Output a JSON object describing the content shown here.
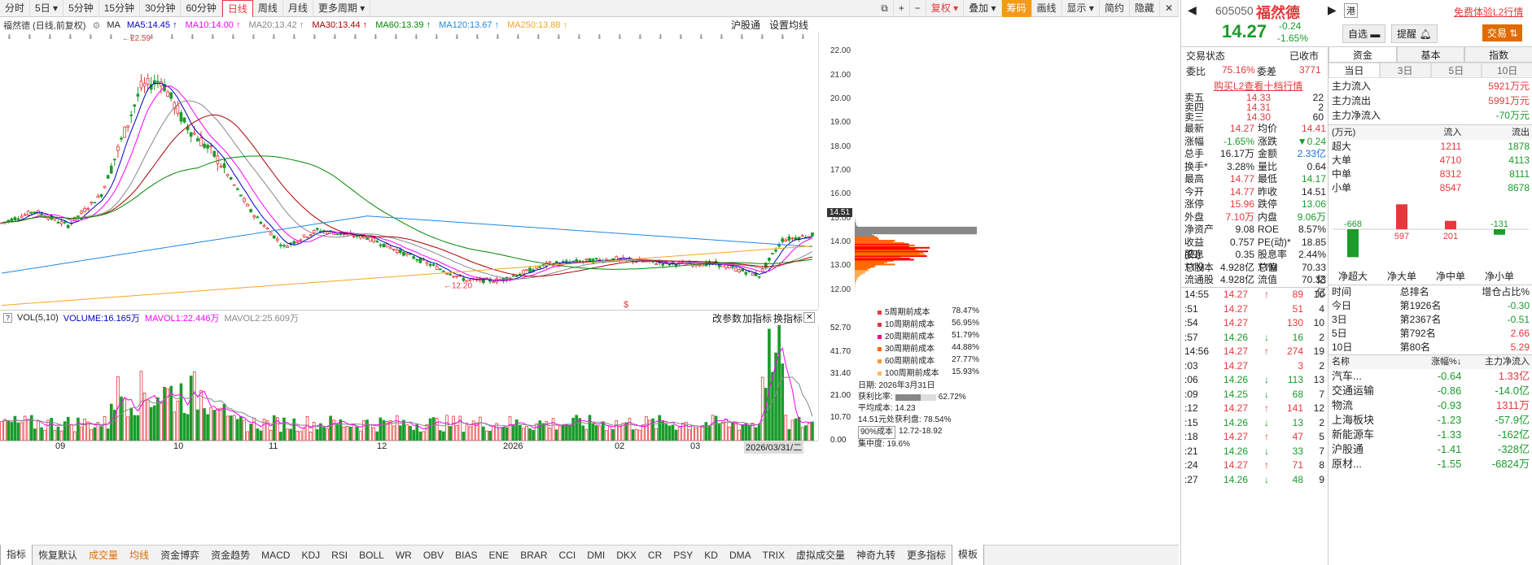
{
  "toolbar": {
    "left": [
      "分时",
      "5日",
      "5分钟",
      "15分钟",
      "30分钟",
      "60分钟",
      "日线",
      "周线",
      "月线",
      "更多周期"
    ],
    "right": [
      "复权",
      "叠加",
      "筹码",
      "画线",
      "显示",
      "简约",
      "隐藏"
    ]
  },
  "ma_row": {
    "label": "福然德 (日线,前复权)",
    "ma": "MA",
    "items": [
      {
        "t": "MA5:14.45",
        "c": "#0000c0"
      },
      {
        "t": "MA10:14.00",
        "c": "#ff00ff"
      },
      {
        "t": "MA20:13.42",
        "c": "#888888"
      },
      {
        "t": "MA30:13.44",
        "c": "#aa0000"
      },
      {
        "t": "MA60:13.39",
        "c": "#008800"
      },
      {
        "t": "MA120:13.67",
        "c": "#1e88e5"
      },
      {
        "t": "MA250:13.88",
        "c": "#f5a623"
      }
    ],
    "hgt": "沪股通",
    "setma": "设置均线"
  },
  "price_axis": [
    "22.00",
    "21.00",
    "20.00",
    "19.00",
    "18.00",
    "17.00",
    "16.00",
    "15.00",
    "14.00",
    "13.00",
    "12.00"
  ],
  "cur_price": "14.51",
  "annotations": {
    "high": "22.59",
    "low": "12.20"
  },
  "vol_row": {
    "label": "VOL(5,10)",
    "volume": "VOLUME:16.165万",
    "mavol1": "MAVOL1:22.446万",
    "mavol2": "MAVOL2:25.609万",
    "btn1": "改参数",
    "btn2": "加指标",
    "btn3": "换指标"
  },
  "vol_axis": [
    "52.70",
    "41.70",
    "31.40",
    "21.00",
    "10.70",
    "0.00"
  ],
  "x_labels": [
    "09",
    "10",
    "11",
    "12",
    "2026",
    "02",
    "03"
  ],
  "x_cursor": "2026/03/31/二",
  "chip_legend": [
    {
      "t": "5周期前成本",
      "v": "78.47%",
      "c": "#e4393c"
    },
    {
      "t": "10周期前成本",
      "v": "56.95%",
      "c": "#e4393c"
    },
    {
      "t": "20周期前成本",
      "v": "51.79%",
      "c": "#ff0080"
    },
    {
      "t": "30周期前成本",
      "v": "44.88%",
      "c": "#ff6600"
    },
    {
      "t": "60周期前成本",
      "v": "27.77%",
      "c": "#ff9933"
    },
    {
      "t": "100周期前成本",
      "v": "15.93%",
      "c": "#ffbb66"
    }
  ],
  "chip_info": {
    "date": "日期: 2026年3月31日",
    "profit_label": "获利比率:",
    "profit_val": "62.72%",
    "avg": "平均成本: 14.23",
    "line": "14.51元处获利盘: 78.54%",
    "cost_sel": "90%成本",
    "cost_range": "12.72-18.92",
    "conc": "集中度: 19.6%"
  },
  "bottom": [
    "指标",
    "恢复默认",
    "成交量",
    "均线",
    "资金博弈",
    "资金趋势",
    "MACD",
    "KDJ",
    "RSI",
    "BOLL",
    "WR",
    "OBV",
    "BIAS",
    "ENE",
    "BRAR",
    "CCI",
    "DMI",
    "DKX",
    "CR",
    "PSY",
    "KD",
    "DMA",
    "TRIX",
    "虚拟成交量",
    "神奇九转",
    "更多指标",
    "模板"
  ],
  "stock": {
    "code": "605050",
    "name": "福然德",
    "market": "港",
    "trial": "免费体验L2行情",
    "price": "14.27",
    "chg": "-0.24",
    "pct": "-1.65%",
    "btn_zx": "自选",
    "btn_tx": "提醒",
    "btn_jy": "交易"
  },
  "status": {
    "trade": "交易状态",
    "state": "已收市",
    "wb_label": "委比",
    "wb": "75.16%",
    "wc_label": "委差",
    "wc": "3771",
    "l2": "购买L2查看十档行情"
  },
  "book": [
    {
      "n": "卖五",
      "p": "14.33",
      "v": "22"
    },
    {
      "n": "卖四",
      "p": "14.31",
      "v": "2"
    },
    {
      "n": "卖三",
      "p": "14.30",
      "v": "60"
    }
  ],
  "quote": [
    [
      "最新",
      "14.27",
      "均价",
      "14.41"
    ],
    [
      "涨幅",
      "-1.65%",
      "涨跌",
      "▼0.24"
    ],
    [
      "总手",
      "16.17万",
      "金额",
      "2.33亿"
    ],
    [
      "换手*",
      "3.28%",
      "量比",
      "0.64"
    ],
    [
      "最高",
      "14.77",
      "最低",
      "14.17"
    ],
    [
      "今开",
      "14.77",
      "昨收",
      "14.51"
    ],
    [
      "涨停",
      "15.96",
      "跌停",
      "13.06"
    ],
    [
      "外盘",
      "7.10万",
      "内盘",
      "9.06万"
    ],
    [
      "净资产",
      "9.08",
      "ROE",
      "8.57%"
    ],
    [
      "收益(四)",
      "0.757",
      "PE(动)*",
      "18.85"
    ],
    [
      "股息TTM",
      "0.35",
      "股息率TTM",
      "2.44%"
    ],
    [
      "总股本",
      "4.928亿",
      "总值",
      "70.33亿"
    ],
    [
      "流通股",
      "4.928亿",
      "流值",
      "70.33亿"
    ]
  ],
  "ticks": [
    [
      "14:55",
      "14.27",
      "↑",
      "89",
      "10"
    ],
    [
      ":51",
      "14.27",
      "",
      "51",
      "4"
    ],
    [
      ":54",
      "14.27",
      "",
      "130",
      "10"
    ],
    [
      ":57",
      "14.26",
      "↓",
      "16",
      "2"
    ],
    [
      "14:56",
      "14.27",
      "↑",
      "274",
      "19"
    ],
    [
      ":03",
      "14.27",
      "",
      "3",
      "2"
    ],
    [
      ":06",
      "14.26",
      "↓",
      "113",
      "13"
    ],
    [
      ":09",
      "14.25",
      "↓",
      "68",
      "7"
    ],
    [
      ":12",
      "14.27",
      "↑",
      "141",
      "12"
    ],
    [
      ":15",
      "14.26",
      "↓",
      "13",
      "2"
    ],
    [
      ":18",
      "14.27",
      "↑",
      "47",
      "5"
    ],
    [
      ":21",
      "14.26",
      "↓",
      "33",
      "7"
    ],
    [
      ":24",
      "14.27",
      "↑",
      "71",
      "8"
    ],
    [
      ":27",
      "14.26",
      "↓",
      "48",
      "9"
    ]
  ],
  "fund": {
    "tabs": [
      "资金",
      "基本",
      "指数"
    ],
    "periods": [
      "当日",
      "3日",
      "5日",
      "10日"
    ],
    "rows": [
      [
        "主力流入",
        "5921万元"
      ],
      [
        "主力流出",
        "5991万元"
      ],
      [
        "主力净流入",
        "-70万元"
      ]
    ],
    "head": [
      "(万元)",
      "流入",
      "流出"
    ],
    "table": [
      [
        "超大",
        "1211",
        "1878"
      ],
      [
        "大单",
        "4710",
        "4113"
      ],
      [
        "中单",
        "8312",
        "8111"
      ],
      [
        "小单",
        "8547",
        "8678"
      ]
    ],
    "bars": [
      {
        "n": "净超大",
        "v": -668
      },
      {
        "n": "净大单",
        "v": 597
      },
      {
        "n": "净中单",
        "v": 201
      },
      {
        "n": "净小单",
        "v": -131
      }
    ]
  },
  "rank": {
    "head": [
      "时间",
      "总排名",
      "增仓占比%"
    ],
    "rows": [
      [
        "今日",
        "第1926名",
        "-0.30"
      ],
      [
        "3日",
        "第2367名",
        "-0.51"
      ],
      [
        "5日",
        "第792名",
        "2.66"
      ],
      [
        "10日",
        "第80名",
        "5.29"
      ]
    ]
  },
  "sector": {
    "head": [
      "名称",
      "涨幅%",
      "主力净流入"
    ],
    "rows": [
      [
        "汽车...",
        "-0.64",
        "1.33亿"
      ],
      [
        "交通运输",
        "-0.86",
        "-14.0亿"
      ],
      [
        "物流",
        "-0.93",
        "1311万"
      ],
      [
        "上海板块",
        "-1.23",
        "-57.9亿"
      ],
      [
        "新能源车",
        "-1.33",
        "-162亿"
      ],
      [
        "沪股通",
        "-1.41",
        "-328亿"
      ],
      [
        "原材...",
        "-1.55",
        "-6824万"
      ]
    ]
  }
}
